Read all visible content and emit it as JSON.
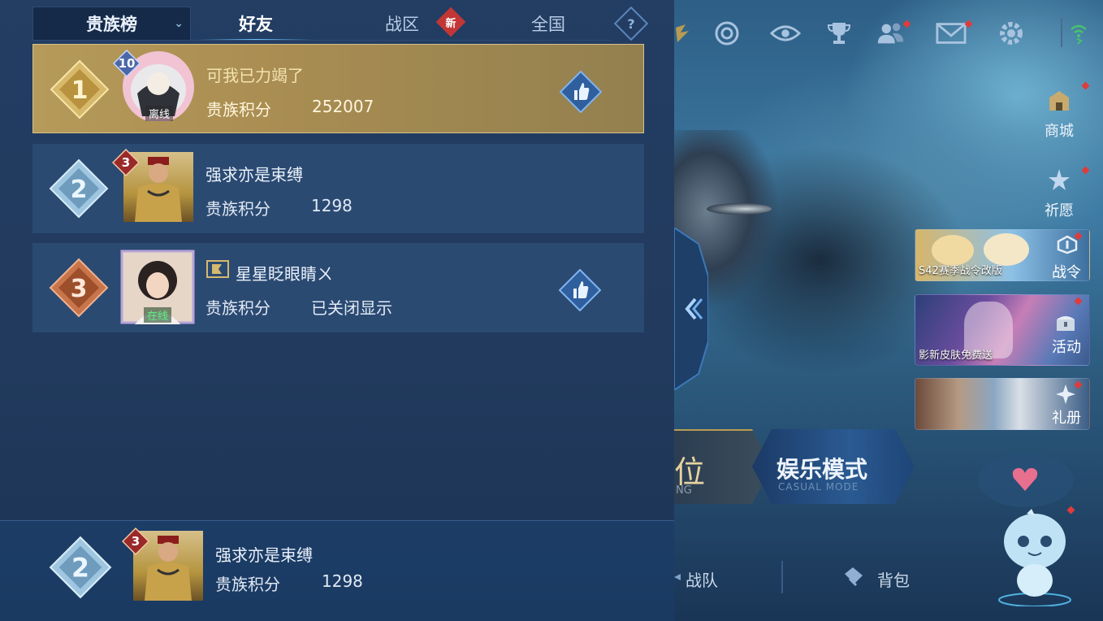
{
  "tabs": {
    "dropdown_label": "贵族榜",
    "items": [
      {
        "label": "好友",
        "active": true
      },
      {
        "label": "战区",
        "badge": "新"
      },
      {
        "label": "全国"
      }
    ],
    "help_label": "?"
  },
  "rows": [
    {
      "rank": "1",
      "vip": "10",
      "name": "可我已力竭了",
      "score_label": "贵族积分",
      "score": "252007",
      "status": "离线",
      "liked": true
    },
    {
      "rank": "2",
      "vip": "3",
      "name": "强求亦是束缚",
      "score_label": "贵族积分",
      "score": "1298",
      "liked": false
    },
    {
      "rank": "3",
      "name": "星星眨眼睛ㄨ",
      "score_label": "贵族积分",
      "score": "已关闭显示",
      "status": "在线",
      "liked": true
    }
  ],
  "self": {
    "rank": "2",
    "vip": "3",
    "name": "强求亦是束缚",
    "score_label": "贵族积分",
    "score": "1298"
  },
  "side_menu": {
    "shop": "商城",
    "wish": "祈愿",
    "battlepass": "战令",
    "battlepass_promo": "S42赛季战令改版",
    "activity": "活动",
    "activity_promo": "影新皮肤免费送",
    "gift": "礼册"
  },
  "modes": {
    "ranked_char": "位",
    "ranked_sub": "NG",
    "casual": "娱乐模式",
    "casual_sub": "CASUAL MODE"
  },
  "bottom_nav": {
    "team": "战队",
    "bag": "背包"
  },
  "colors": {
    "gold_row": "#b69a5a",
    "row": "#2b4a72",
    "panel": "#233d63",
    "red_dot": "#e03b3b"
  }
}
